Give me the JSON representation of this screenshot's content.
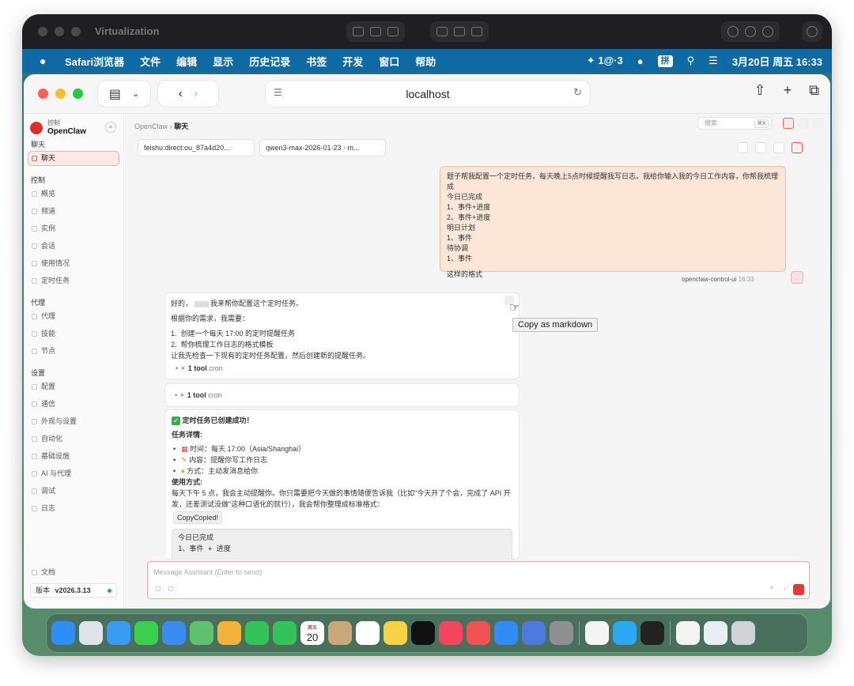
{
  "vm": {
    "title": "Virtualization"
  },
  "menubar": {
    "app": "Safari浏览器",
    "items": [
      "文件",
      "编辑",
      "显示",
      "历史记录",
      "书签",
      "开发",
      "窗口",
      "帮助"
    ],
    "status": {
      "vpn": "1@·3",
      "ime": "拼",
      "datetime": "3月20日 周五 16:33"
    }
  },
  "browser": {
    "url": "localhost"
  },
  "sidebar": {
    "brand_top": "控制",
    "brand_name": "OpenClaw",
    "sections": [
      {
        "title": "聊天",
        "items": [
          "聊天"
        ]
      },
      {
        "title": "控制",
        "items": [
          "概览",
          "频道",
          "实例",
          "会话",
          "使用情况",
          "定时任务"
        ]
      },
      {
        "title": "代理",
        "items": [
          "代理",
          "技能",
          "节点"
        ]
      },
      {
        "title": "设置",
        "items": [
          "配置",
          "通信",
          "外观与设置",
          "自动化",
          "基础设施",
          "AI 与代理",
          "调试",
          "日志"
        ]
      }
    ],
    "docs": "文档",
    "version_label": "版本",
    "version": "v2026.3.13"
  },
  "header": {
    "crumb_root": "OpenClaw",
    "crumb_sep": "›",
    "crumb_current": "聊天",
    "search_placeholder": "搜索",
    "search_shortcut": "⌘K"
  },
  "session": {
    "chip_session": "feishu:direct:ou_87a4d20...",
    "chip_model": "qwen3-max-2026-01-23 · m..."
  },
  "messages": {
    "user": {
      "lines": [
        "题子帮我配置一个定时任务，每天晚上5点时候提醒我写日志。我给你输入我的今日工作内容，你帮我梳理成",
        "今日已完成",
        "1、事件+进度",
        "2、事件+进度",
        "明日计划",
        "1、事件",
        "待协调",
        "1、事件",
        "",
        "这样的格式"
      ],
      "sender": "openclaw-control-ui",
      "time": "16:33"
    },
    "assistant1": {
      "greeting_a": "好的，",
      "greeting_b": "我来帮你配置这个定时任务。",
      "need": "根据你的需求，我需要：",
      "steps": [
        "创建一个每天 17:00 的定时提醒任务",
        "帮你梳理工作日志的格式模板"
      ],
      "check": "让我先检查一下现有的定时任务配置，然后创建新的提醒任务。",
      "tool_count": "1 tool",
      "tool_name": "cron"
    },
    "assistant2": {
      "tool_count": "1 tool",
      "tool_name": "cron"
    },
    "assistant3": {
      "success": "定时任务已创建成功！",
      "details_title": "任务详情:",
      "details": [
        "时间：每天 17:00（Asia/Shanghai）",
        "内容：提醒你写工作日志",
        "方式：主动发消息给你"
      ],
      "usage_title": "使用方式:",
      "usage_text": "每天下午 5 点，我会主动提醒你。你只需要把今天做的事情随便告诉我（比如\"今天开了个会，完成了 API 开发，还差测试没做\"这种口语化的就行），我会帮你整理成标准格式：",
      "copy_label": "CopyCopied!",
      "code_lines": [
        "今日已完成",
        "1、事件 + 进度"
      ]
    }
  },
  "tooltip": "Copy as markdown",
  "composer": {
    "placeholder": "Message Assistant (Enter to send)"
  },
  "dock": {
    "calendar_month": "周五",
    "calendar_day": "20",
    "apps": [
      {
        "name": "finder",
        "color": "#2f8ef4"
      },
      {
        "name": "launchpad",
        "color": "#dfe3ea"
      },
      {
        "name": "safari",
        "color": "#3a9cf0"
      },
      {
        "name": "messages",
        "color": "#3ccf4e"
      },
      {
        "name": "mail",
        "color": "#3b8cf2"
      },
      {
        "name": "maps",
        "color": "#5fc16b"
      },
      {
        "name": "photos",
        "color": "#f2b33d"
      },
      {
        "name": "facetime",
        "color": "#33c358"
      },
      {
        "name": "phone",
        "color": "#33c358"
      },
      {
        "name": "calendar",
        "color": "#ffffff"
      },
      {
        "name": "contacts",
        "color": "#c9a97a"
      },
      {
        "name": "reminders",
        "color": "#ffffff"
      },
      {
        "name": "notes",
        "color": "#f7d247"
      },
      {
        "name": "tv",
        "color": "#111111"
      },
      {
        "name": "music",
        "color": "#f5455f"
      },
      {
        "name": "rocket",
        "color": "#f25252"
      },
      {
        "name": "app-store",
        "color": "#2e8cf4"
      },
      {
        "name": "simulator",
        "color": "#4e7ae0"
      },
      {
        "name": "settings",
        "color": "#8e8e93"
      },
      {
        "name": "textedit",
        "color": "#f4f4f4"
      },
      {
        "name": "feishu",
        "color": "#2da8f2"
      },
      {
        "name": "terminal",
        "color": "#222222"
      },
      {
        "name": "document",
        "color": "#f4f4f4"
      },
      {
        "name": "preview",
        "color": "#e9eef5"
      },
      {
        "name": "trash",
        "color": "#cfd3d8"
      }
    ]
  }
}
